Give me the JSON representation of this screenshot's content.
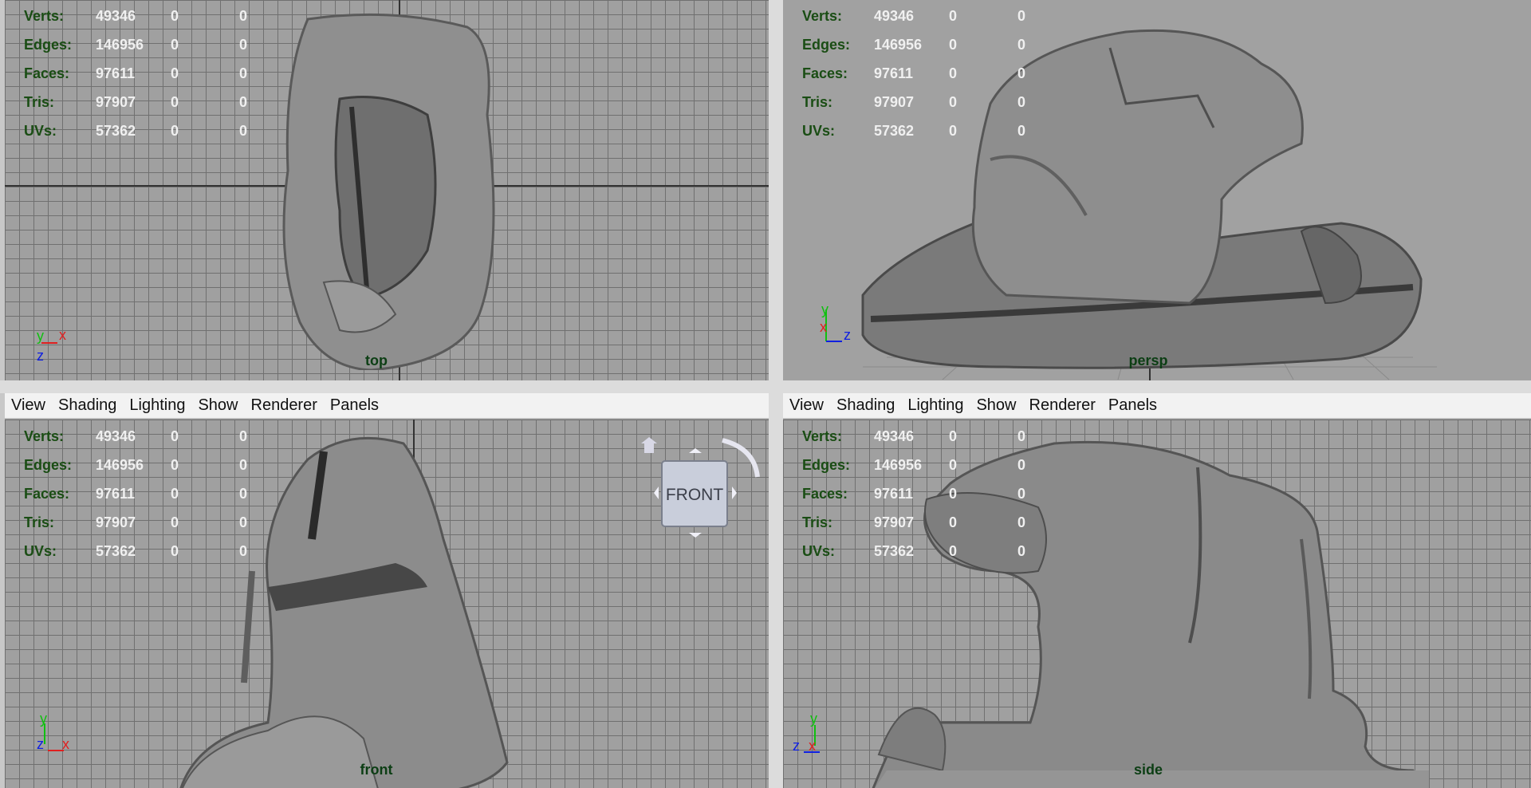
{
  "menus": [
    "View",
    "Shading",
    "Lighting",
    "Show",
    "Renderer",
    "Panels"
  ],
  "hud": [
    {
      "label": "Verts:",
      "value": "49346",
      "a": "0",
      "b": "0"
    },
    {
      "label": "Edges:",
      "value": "146956",
      "a": "0",
      "b": "0"
    },
    {
      "label": "Faces:",
      "value": "97611",
      "a": "0",
      "b": "0"
    },
    {
      "label": "Tris:",
      "value": "97907",
      "a": "0",
      "b": "0"
    },
    {
      "label": "UVs:",
      "value": "57362",
      "a": "0",
      "b": "0"
    }
  ],
  "viewports": {
    "top": {
      "camera": "top",
      "axes": {
        "up": "Y",
        "right": "X",
        "depth": "Z"
      }
    },
    "persp": {
      "camera": "persp",
      "axes": {
        "up": "Y",
        "right": "Z",
        "depth": "X"
      }
    },
    "front": {
      "camera": "front",
      "axes": {
        "up": "Y",
        "right": "X",
        "depth": "Z"
      }
    },
    "side": {
      "camera": "side",
      "axes": {
        "up": "Y",
        "right": "X",
        "depth": "Z"
      }
    }
  },
  "viewcube": {
    "face_label": "FRONT"
  },
  "colors": {
    "x_axis": "#e02020",
    "y_axis": "#10c010",
    "z_axis": "#1020e0",
    "hud_label": "#1a4d14",
    "camera_label": "#0c3e14"
  }
}
